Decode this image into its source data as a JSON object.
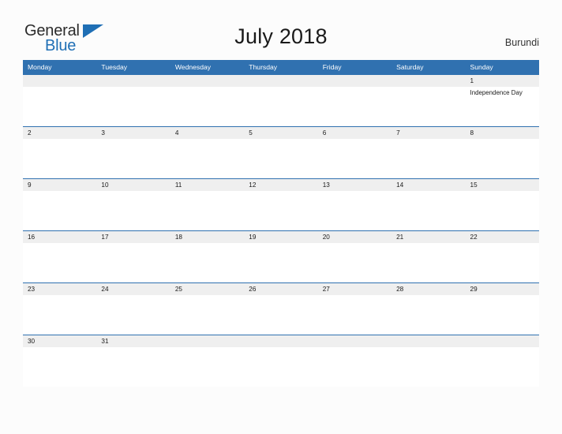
{
  "header": {
    "logo": {
      "word_dark": "General",
      "word_blue": "Blue",
      "triangle_icon": "blue-triangle-icon",
      "brand_blue": "#1F6FB5",
      "brand_dark": "#2B2B2B"
    },
    "title": "July 2018",
    "locale": "Burundi"
  },
  "theme": {
    "header_blue": "#3071B0",
    "date_band_gray": "#EFEFEF",
    "page_background": "#FCFCFC",
    "cell_background": "#FFFFFF"
  },
  "calendar": {
    "weekdays": [
      "Monday",
      "Tuesday",
      "Wednesday",
      "Thursday",
      "Friday",
      "Saturday",
      "Sunday"
    ],
    "weeks": [
      {
        "dates": [
          "",
          "",
          "",
          "",
          "",
          "",
          "1"
        ],
        "events": [
          "",
          "",
          "",
          "",
          "",
          "",
          "Independence Day"
        ]
      },
      {
        "dates": [
          "2",
          "3",
          "4",
          "5",
          "6",
          "7",
          "8"
        ],
        "events": [
          "",
          "",
          "",
          "",
          "",
          "",
          ""
        ]
      },
      {
        "dates": [
          "9",
          "10",
          "11",
          "12",
          "13",
          "14",
          "15"
        ],
        "events": [
          "",
          "",
          "",
          "",
          "",
          "",
          ""
        ]
      },
      {
        "dates": [
          "16",
          "17",
          "18",
          "19",
          "20",
          "21",
          "22"
        ],
        "events": [
          "",
          "",
          "",
          "",
          "",
          "",
          ""
        ]
      },
      {
        "dates": [
          "23",
          "24",
          "25",
          "26",
          "27",
          "28",
          "29"
        ],
        "events": [
          "",
          "",
          "",
          "",
          "",
          "",
          ""
        ]
      },
      {
        "dates": [
          "30",
          "31",
          "",
          "",
          "",
          "",
          ""
        ],
        "events": [
          "",
          "",
          "",
          "",
          "",
          "",
          ""
        ]
      }
    ]
  }
}
